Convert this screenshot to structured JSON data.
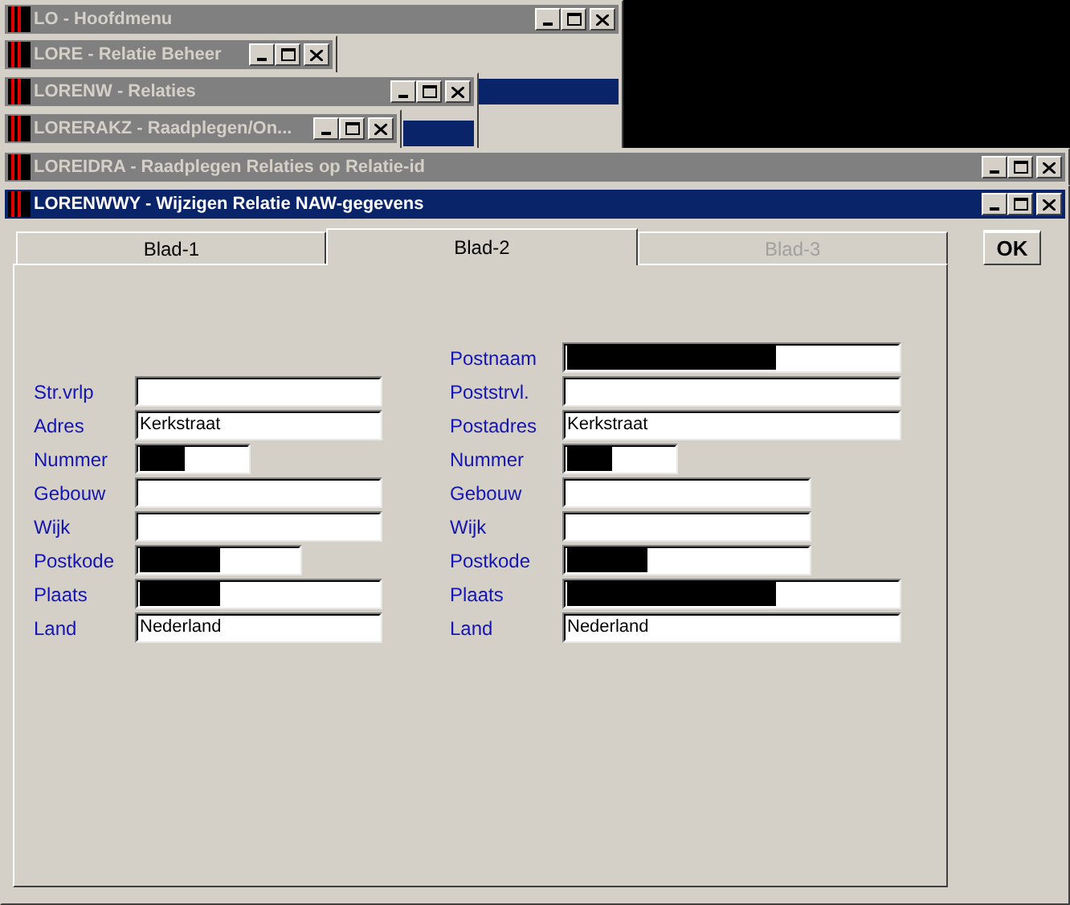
{
  "windows": [
    {
      "title": "LO - Hoofdmenu",
      "active": false
    },
    {
      "title": "LORE - Relatie Beheer",
      "active": false
    },
    {
      "title": "LORENW - Relaties",
      "active": false
    },
    {
      "title": "LORERAKZ - Raadplegen/On...",
      "active": false
    },
    {
      "title": "LOREIDRA - Raadplegen Relaties op Relatie-id",
      "active": false
    },
    {
      "title": "LORENWWY - Wijzigen Relatie NAW-gegevens",
      "active": true
    }
  ],
  "tabs": [
    {
      "label": "Blad-1",
      "selected": false,
      "disabled": false
    },
    {
      "label": "Blad-2",
      "selected": true,
      "disabled": false
    },
    {
      "label": "Blad-3",
      "selected": false,
      "disabled": true
    }
  ],
  "ok_button": "OK",
  "left_fields": [
    {
      "label": "Str.vrlp",
      "redacted": false,
      "kind": "long"
    },
    {
      "label": "Adres",
      "value": "Kerkstraat",
      "redacted": false,
      "kind": "long"
    },
    {
      "label": "Nummer",
      "redacted": true,
      "kind": "short"
    },
    {
      "label": "Gebouw",
      "redacted": false,
      "kind": "long"
    },
    {
      "label": "Wijk",
      "redacted": false,
      "kind": "long"
    },
    {
      "label": "Postkode",
      "redacted": true,
      "kind": "medium"
    },
    {
      "label": "Plaats",
      "redacted": true,
      "kind": "long"
    },
    {
      "label": "Land",
      "value": "Nederland",
      "redacted": false,
      "kind": "long"
    }
  ],
  "right_fields": [
    {
      "label": "Postnaam",
      "redacted": true,
      "kind": "long"
    },
    {
      "label": "Poststrvl.",
      "redacted": false,
      "kind": "long"
    },
    {
      "label": "Postadres",
      "value": "Kerkstraat",
      "redacted": false,
      "kind": "long"
    },
    {
      "label": "Nummer",
      "redacted": true,
      "kind": "short"
    },
    {
      "label": "Gebouw",
      "redacted": false,
      "kind": "medium"
    },
    {
      "label": "Wijk",
      "redacted": false,
      "kind": "medium"
    },
    {
      "label": "Postkode",
      "redacted": true,
      "kind": "medium"
    },
    {
      "label": "Plaats",
      "redacted": true,
      "kind": "long"
    },
    {
      "label": "Land",
      "value": "Nederland",
      "redacted": false,
      "kind": "long"
    }
  ]
}
